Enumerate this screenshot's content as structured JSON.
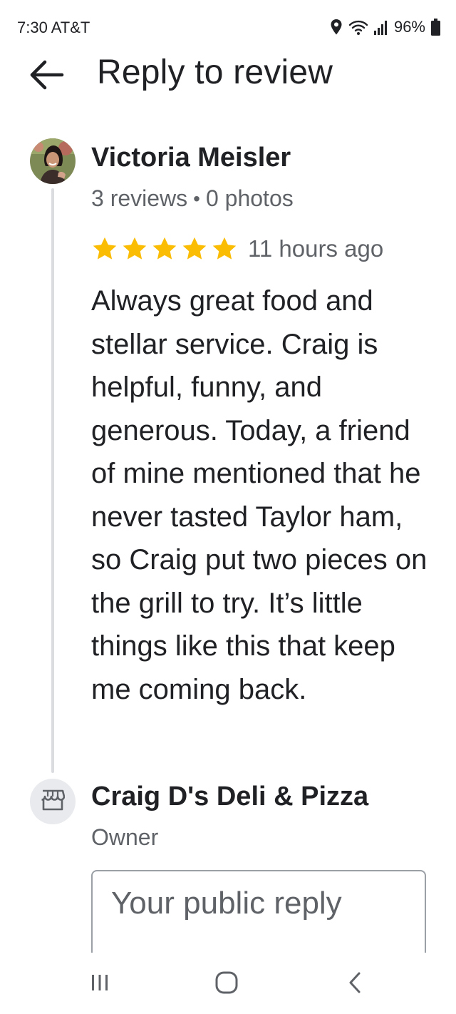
{
  "status_bar": {
    "time_carrier": "7:30 AT&T",
    "battery": "96%",
    "icons": [
      "location-icon",
      "wifi-icon",
      "signal-icon",
      "battery-icon"
    ]
  },
  "header": {
    "title": "Reply to review",
    "back_icon": "arrow-left-icon"
  },
  "review": {
    "reviewer_name": "Victoria Meisler",
    "reviews_count": "3 reviews",
    "meta_separator": "•",
    "photos_count": "0 photos",
    "rating": 5,
    "star_color": "#fbbc04",
    "time_ago": "11 hours ago",
    "text": "Always great food and stellar service. Craig is helpful, funny, and generous. Today, a friend of mine mentioned that he never tasted Taylor ham, so Craig put two pieces on the grill to try. It’s little things like this that keep me coming back."
  },
  "owner": {
    "icon": "storefront-icon",
    "name": "Craig D's Deli & Pizza",
    "role": "Owner"
  },
  "reply": {
    "placeholder": "Your public reply",
    "value": ""
  },
  "nav_bar": {
    "icons": [
      "recents-icon",
      "home-icon",
      "back-icon"
    ]
  }
}
